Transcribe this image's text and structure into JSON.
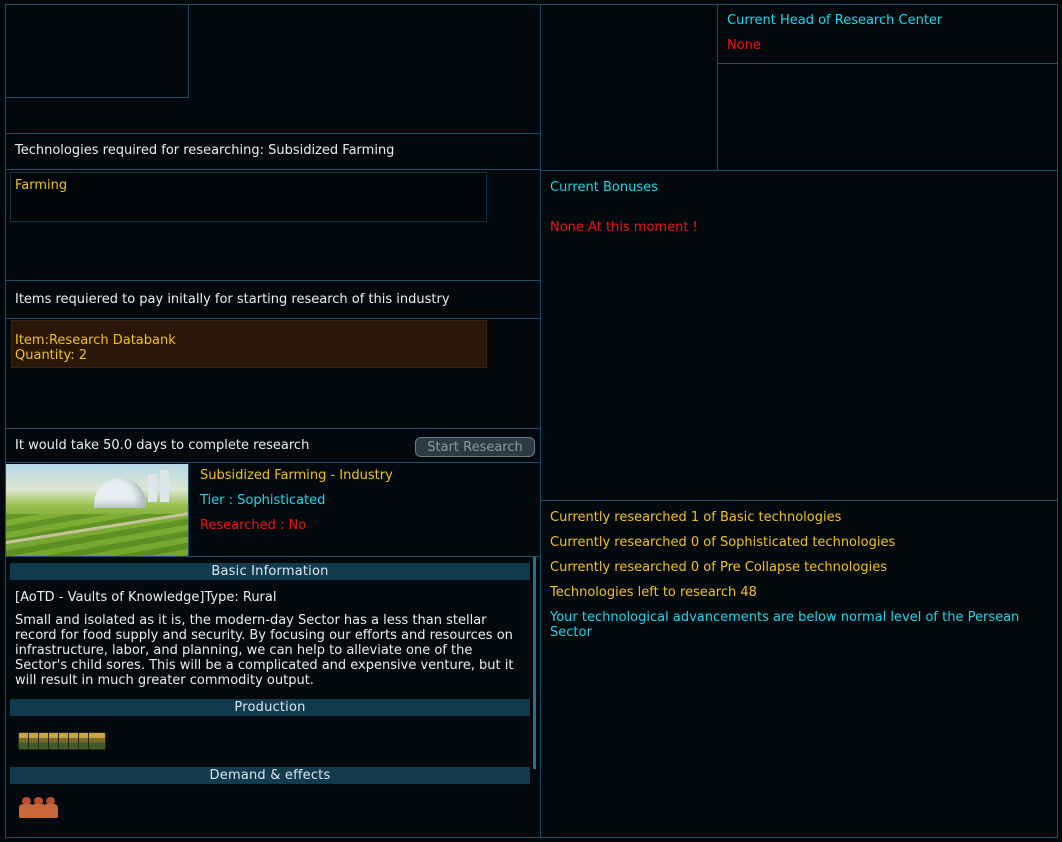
{
  "head": {
    "label": "Current Head of Research Center",
    "value": "None"
  },
  "requirements": {
    "tech_header": "Technologies required for researching: Subsidized Farming",
    "tech_item": "Farming",
    "items_header": "Items requiered to pay initally for starting research of this industry",
    "item_line": "Item:Research Databank",
    "qty_line": "Quantity: 2",
    "time_text": "It would take 50.0 days to complete research",
    "start_button": "Start Research"
  },
  "tech": {
    "name": "Subsidized Farming - Industry",
    "tier": "Tier : Sophisticated",
    "researched": "Researched : No"
  },
  "info": {
    "basic_header": "Basic Information",
    "type_line": "[AoTD - Vaults of Knowledge]Type: Rural",
    "description": "Small and isolated as it is, the modern-day Sector has a less than stellar record for food supply and security. By focusing our efforts and resources on infrastructure, labor, and planning, we can help to alleviate one of the Sector's child sores. This will be a complicated and expensive venture, but it will result in much greater commodity output.",
    "production_header": "Production",
    "production_icons": [
      "food-crate-icon",
      "food-crate-icon",
      "food-crate-icon",
      "food-crate-icon",
      "food-crate-icon",
      "food-crate-icon",
      "food-crate-icon",
      "food-crate-icon"
    ],
    "demand_header": "Demand & effects",
    "demand_icons": [
      "crew-icon",
      "crew-icon",
      "crew-icon"
    ]
  },
  "bonuses": {
    "label": "Current Bonuses",
    "value": "None At this moment !"
  },
  "summary": {
    "basic": "Currently researched 1 of Basic technologies",
    "sophisticated": "Currently researched 0 of Sophisticated technologies",
    "precollapse": "Currently researched 0 of Pre Collapse technologies",
    "left": "Technologies left to research 48",
    "warning": "Your technological advancements are below normal level of the Persean Sector"
  },
  "colors": {
    "border": "#1d4f66",
    "yellow": "#f2c21b",
    "cyan": "#1fd6ea",
    "red": "#f01414",
    "header_bar": "#133b4e",
    "item_box": "#2a1606"
  }
}
